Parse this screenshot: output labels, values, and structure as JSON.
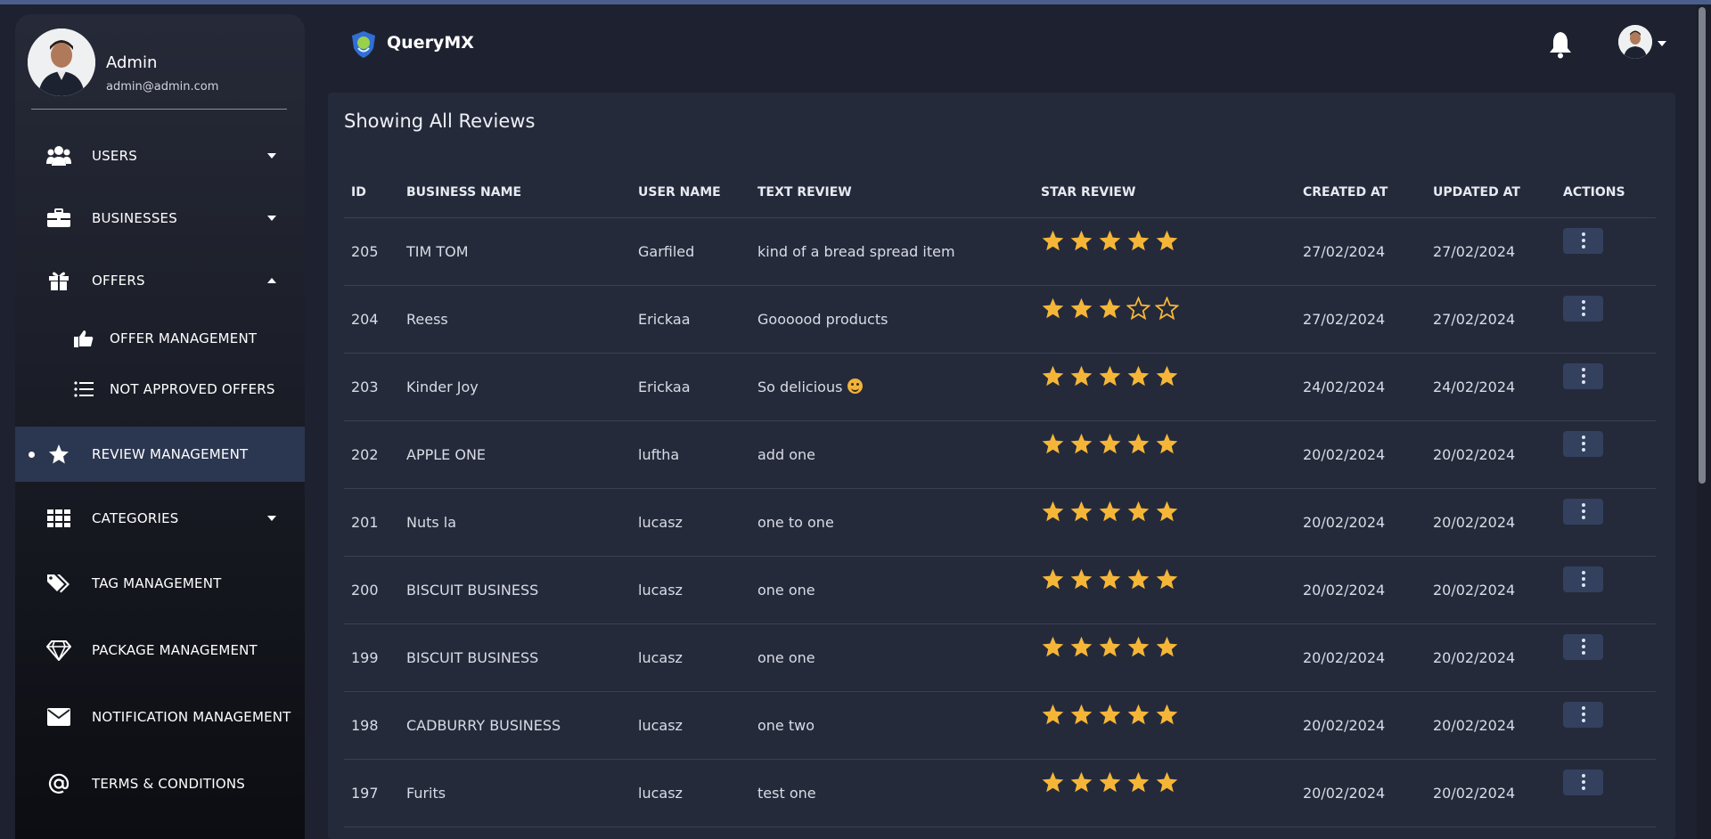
{
  "app": {
    "brand": "QueryMX"
  },
  "profile": {
    "name": "Admin",
    "email": "admin@admin.com"
  },
  "sidebar": {
    "items": [
      {
        "label": "USERS",
        "icon": "users-icon"
      },
      {
        "label": "BUSINESSES",
        "icon": "briefcase-icon"
      },
      {
        "label": "OFFERS",
        "icon": "gift-icon"
      },
      {
        "label": "OFFER MANAGEMENT",
        "icon": "thumbs-up-icon"
      },
      {
        "label": "NOT APPROVED OFFERS",
        "icon": "list-icon"
      },
      {
        "label": "REVIEW MANAGEMENT",
        "icon": "star-icon"
      },
      {
        "label": "CATEGORIES",
        "icon": "grid-icon"
      },
      {
        "label": "TAG MANAGEMENT",
        "icon": "tags-icon"
      },
      {
        "label": "PACKAGE MANAGEMENT",
        "icon": "diamond-icon"
      },
      {
        "label": "NOTIFICATION MANAGEMENT",
        "icon": "envelope-icon"
      },
      {
        "label": "TERMS & CONDITIONS",
        "icon": "at-icon"
      }
    ]
  },
  "main": {
    "title": "Showing All Reviews",
    "columns": [
      "ID",
      "BUSINESS NAME",
      "USER NAME",
      "TEXT REVIEW",
      "STAR REVIEW",
      "CREATED AT",
      "UPDATED AT",
      "ACTIONS"
    ],
    "rows": [
      {
        "id": "205",
        "business": "TIM TOM",
        "user": "Garfiled",
        "text": "kind of a bread spread item",
        "stars": 5,
        "created": "27/02/2024",
        "updated": "27/02/2024"
      },
      {
        "id": "204",
        "business": "Reess",
        "user": "Erickaa",
        "text": "Goooood products",
        "stars": 3,
        "created": "27/02/2024",
        "updated": "27/02/2024"
      },
      {
        "id": "203",
        "business": "Kinder Joy",
        "user": "Erickaa",
        "text": "So delicious",
        "emoji": true,
        "stars": 5,
        "created": "24/02/2024",
        "updated": "24/02/2024"
      },
      {
        "id": "202",
        "business": "APPLE ONE",
        "user": "luftha",
        "text": "add one",
        "stars": 5,
        "created": "20/02/2024",
        "updated": "20/02/2024"
      },
      {
        "id": "201",
        "business": "Nuts la",
        "user": "lucasz",
        "text": "one to one",
        "stars": 5,
        "created": "20/02/2024",
        "updated": "20/02/2024"
      },
      {
        "id": "200",
        "business": "BISCUIT BUSINESS",
        "user": "lucasz",
        "text": "one one",
        "stars": 5,
        "created": "20/02/2024",
        "updated": "20/02/2024"
      },
      {
        "id": "199",
        "business": "BISCUIT BUSINESS",
        "user": "lucasz",
        "text": "one one",
        "stars": 5,
        "created": "20/02/2024",
        "updated": "20/02/2024"
      },
      {
        "id": "198",
        "business": "CADBURRY BUSINESS",
        "user": "lucasz",
        "text": "one two",
        "stars": 5,
        "created": "20/02/2024",
        "updated": "20/02/2024"
      },
      {
        "id": "197",
        "business": "Furits",
        "user": "lucasz",
        "text": "test one",
        "stars": 5,
        "created": "20/02/2024",
        "updated": "20/02/2024"
      }
    ]
  },
  "colors": {
    "star": "#f5b638",
    "accent": "#2b3650",
    "card": "#252a3b"
  }
}
